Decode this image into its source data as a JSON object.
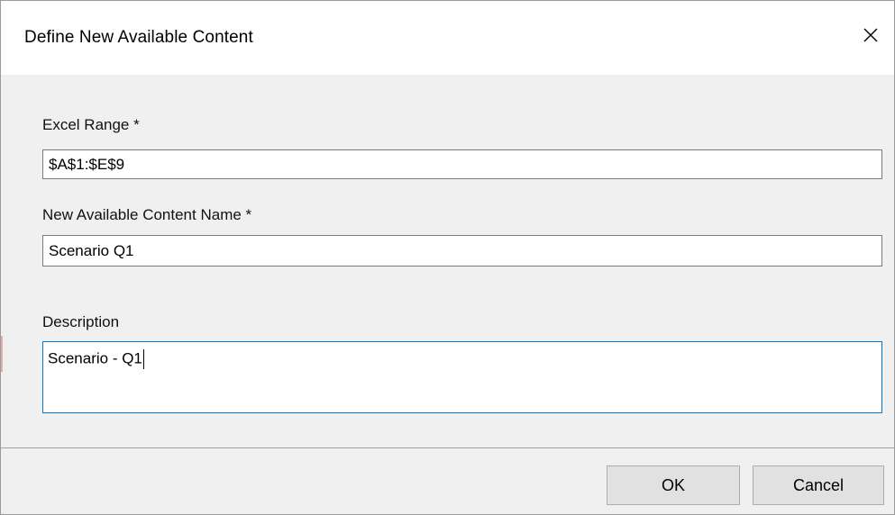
{
  "window": {
    "title": "Define New Available Content",
    "close_icon": "close-icon"
  },
  "form": {
    "excel_range": {
      "label": "Excel Range *",
      "value": "$A$1:$E$9"
    },
    "content_name": {
      "label": "New Available Content Name *",
      "value": "Scenario Q1"
    },
    "description": {
      "label": "Description",
      "value": "Scenario - Q1"
    }
  },
  "buttons": {
    "ok_label": "OK",
    "cancel_label": "Cancel"
  },
  "colors": {
    "focus_border": "#0078d7",
    "dialog_bg": "#f0f0f0",
    "titlebar_bg": "#ffffff",
    "button_bg": "#e1e1e1"
  }
}
